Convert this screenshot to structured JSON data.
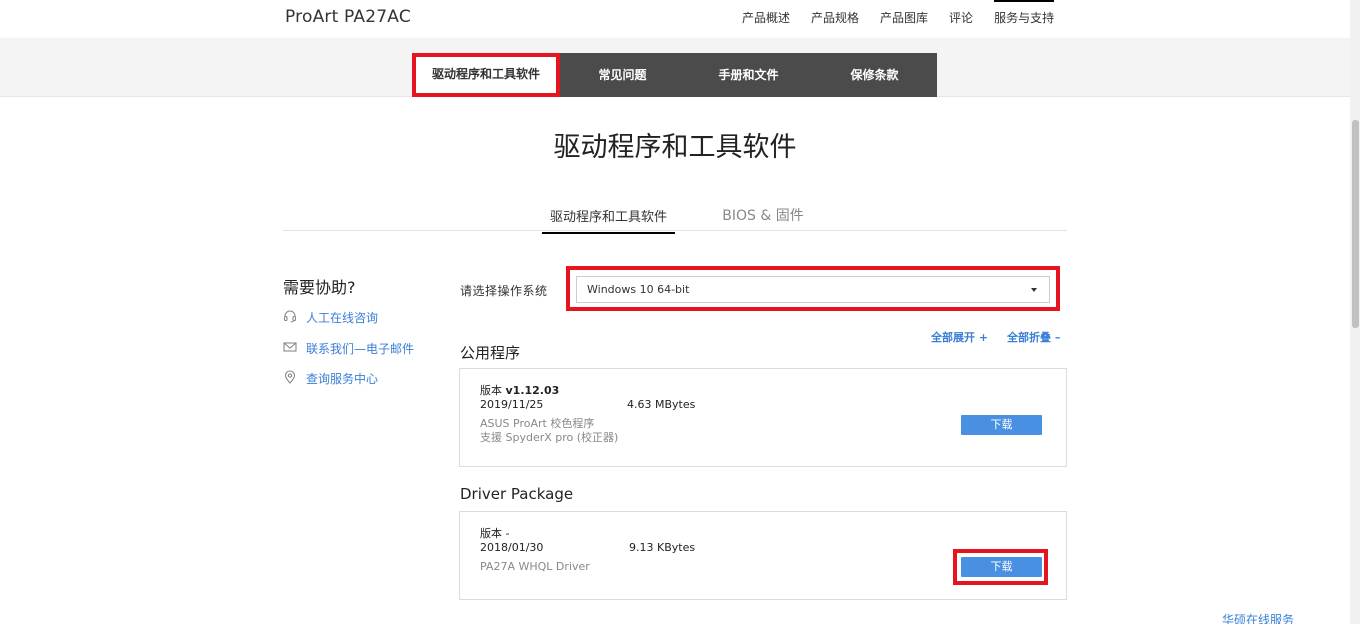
{
  "header": {
    "product_title": "ProArt PA27AC",
    "nav": [
      "产品概述",
      "产品规格",
      "产品图库",
      "评论",
      "服务与支持"
    ]
  },
  "subnav": {
    "tabs": [
      "驱动程序和工具软件",
      "常见问题",
      "手册和文件",
      "保修条款"
    ]
  },
  "page_title": "驱动程序和工具软件",
  "content_tabs": {
    "drivers": "驱动程序和工具软件",
    "bios": "BIOS & 固件"
  },
  "help": {
    "title": "需要协助?",
    "chat": "人工在线咨询",
    "email": "联系我们—电子邮件",
    "service_center": "查询服务中心"
  },
  "os_select": {
    "label": "请选择操作系统",
    "value": "Windows 10 64-bit"
  },
  "expand": {
    "expand_all": "全部展开 +",
    "collapse_all": "全部折叠 –"
  },
  "sections": [
    {
      "title": "公用程序",
      "item": {
        "version_label": "版本 ",
        "version_value": "v1.12.03",
        "date": "2019/11/25",
        "size": "4.63 MBytes",
        "desc_line1": "ASUS ProArt 校色程序",
        "desc_line2": "支援 SpyderX pro (校正器)",
        "download": "下载"
      }
    },
    {
      "title": "Driver Package",
      "item": {
        "version_label": "版本 -",
        "date": "2018/01/30",
        "size": "9.13 KBytes",
        "desc_line1": "PA27A WHQL Driver",
        "download": "下载"
      }
    }
  ],
  "footer": {
    "online_service": "华硕在线服务"
  },
  "colors": {
    "accent_blue": "#4a90e2",
    "link_blue": "#3a7fd5",
    "highlight_red": "#e5141e",
    "subnav_dark": "#4b4b4b"
  }
}
